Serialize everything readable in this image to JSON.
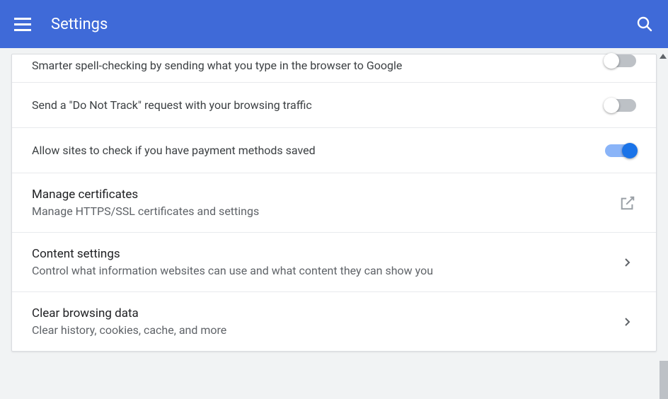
{
  "header": {
    "title": "Settings"
  },
  "rows": {
    "spellcheck": {
      "text": "Smarter spell-checking by sending what you type in the browser to Google"
    },
    "dnt": {
      "text": "Send a \"Do Not Track\" request with your browsing traffic"
    },
    "payment": {
      "text": "Allow sites to check if you have payment methods saved"
    },
    "certificates": {
      "title": "Manage certificates",
      "subtitle": "Manage HTTPS/SSL certificates and settings"
    },
    "content": {
      "title": "Content settings",
      "subtitle": "Control what information websites can use and what content they can show you"
    },
    "clear": {
      "title": "Clear browsing data",
      "subtitle": "Clear history, cookies, cache, and more"
    }
  }
}
